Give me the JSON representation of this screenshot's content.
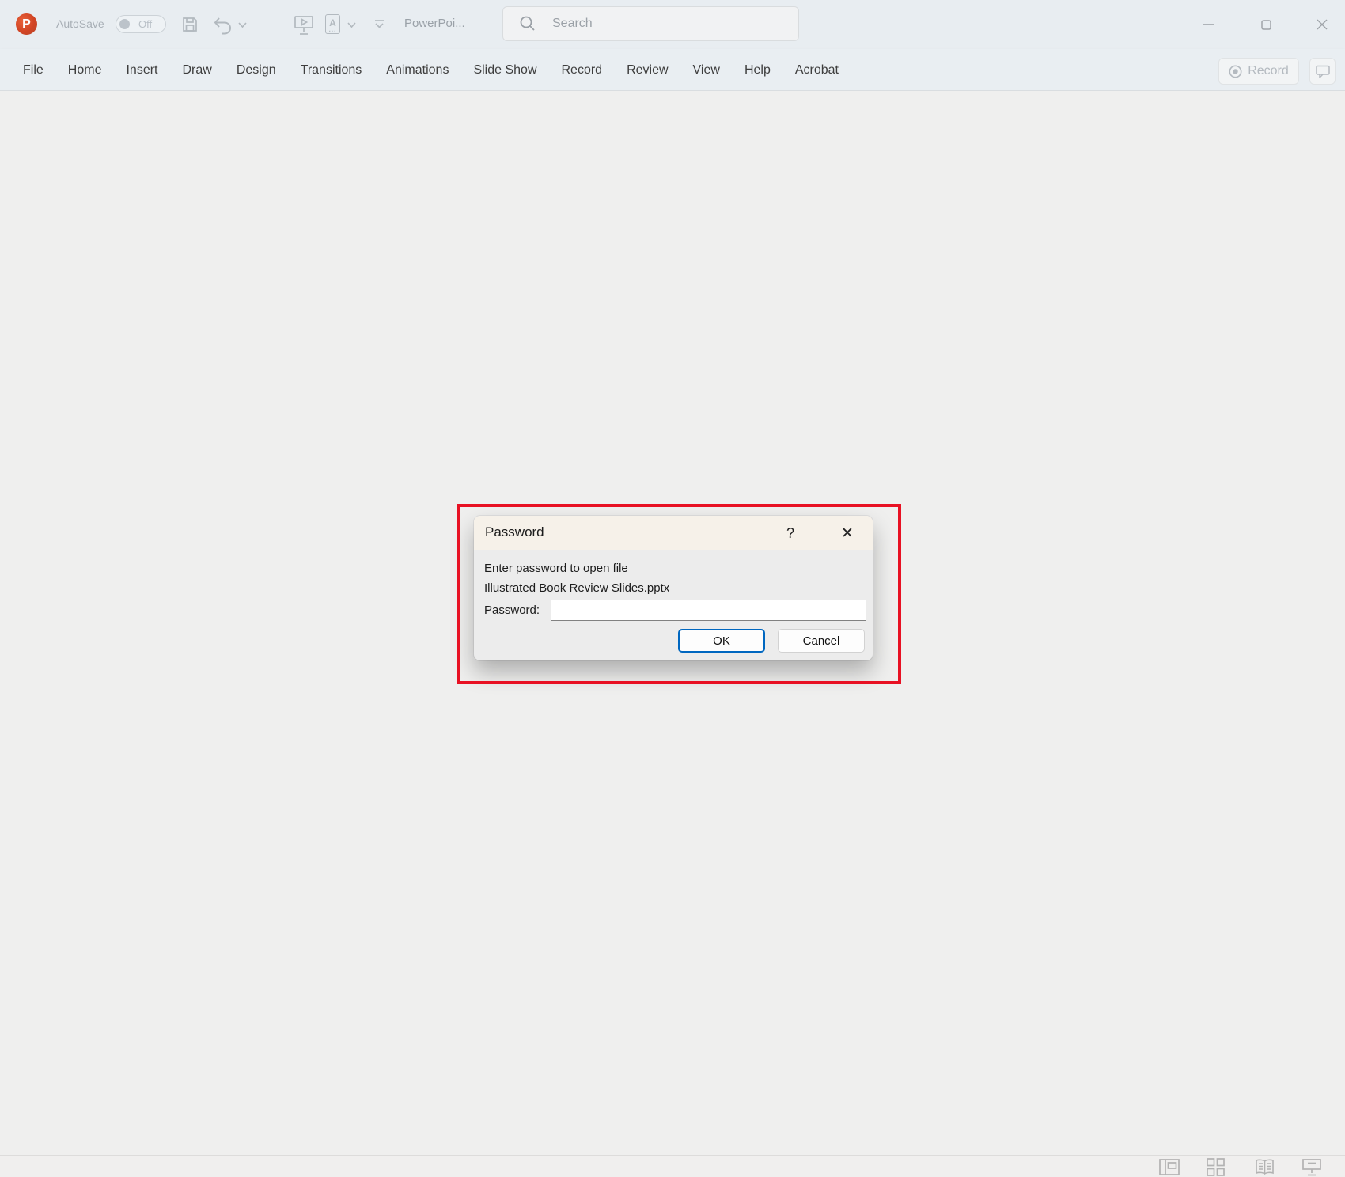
{
  "titlebar": {
    "autosave_label": "AutoSave",
    "autosave_state": "Off",
    "document_title": "PowerPoi...",
    "search_placeholder": "Search"
  },
  "menu": {
    "items": [
      "File",
      "Home",
      "Insert",
      "Draw",
      "Design",
      "Transitions",
      "Animations",
      "Slide Show",
      "Record",
      "Review",
      "View",
      "Help",
      "Acrobat"
    ]
  },
  "menubar_right": {
    "record_label": "Record"
  },
  "dialog": {
    "title": "Password",
    "help_glyph": "?",
    "close_glyph": "✕",
    "message": "Enter password to open file",
    "filename": "Illustrated Book Review Slides.pptx",
    "password_label": "Password:",
    "password_value": "",
    "ok_label": "OK",
    "cancel_label": "Cancel"
  },
  "icons": {
    "powerpoint_logo": "P",
    "save": "floppy-disk",
    "undo": "curved-arrow-left",
    "start-slideshow": "monitor-play",
    "font-style": "A",
    "qat-more": "line-over-chevron",
    "search": "magnifier",
    "record": "dot-in-circle",
    "comments": "speech-bubble",
    "minimize": "horizontal-line",
    "maximize": "square-outline",
    "close": "x-cross",
    "view-normal": "slide-with-panel",
    "view-slide-sorter": "grid-of-squares",
    "view-reading": "open-book",
    "view-slideshow": "screen-on-stand"
  },
  "annotation": {
    "color": "#e81123",
    "purpose": "highlight-password-dialog"
  },
  "colors": {
    "accent_blue": "#0067c0",
    "dialog_titlebar": "#f6f1e9",
    "chrome": "#e8edf1"
  }
}
